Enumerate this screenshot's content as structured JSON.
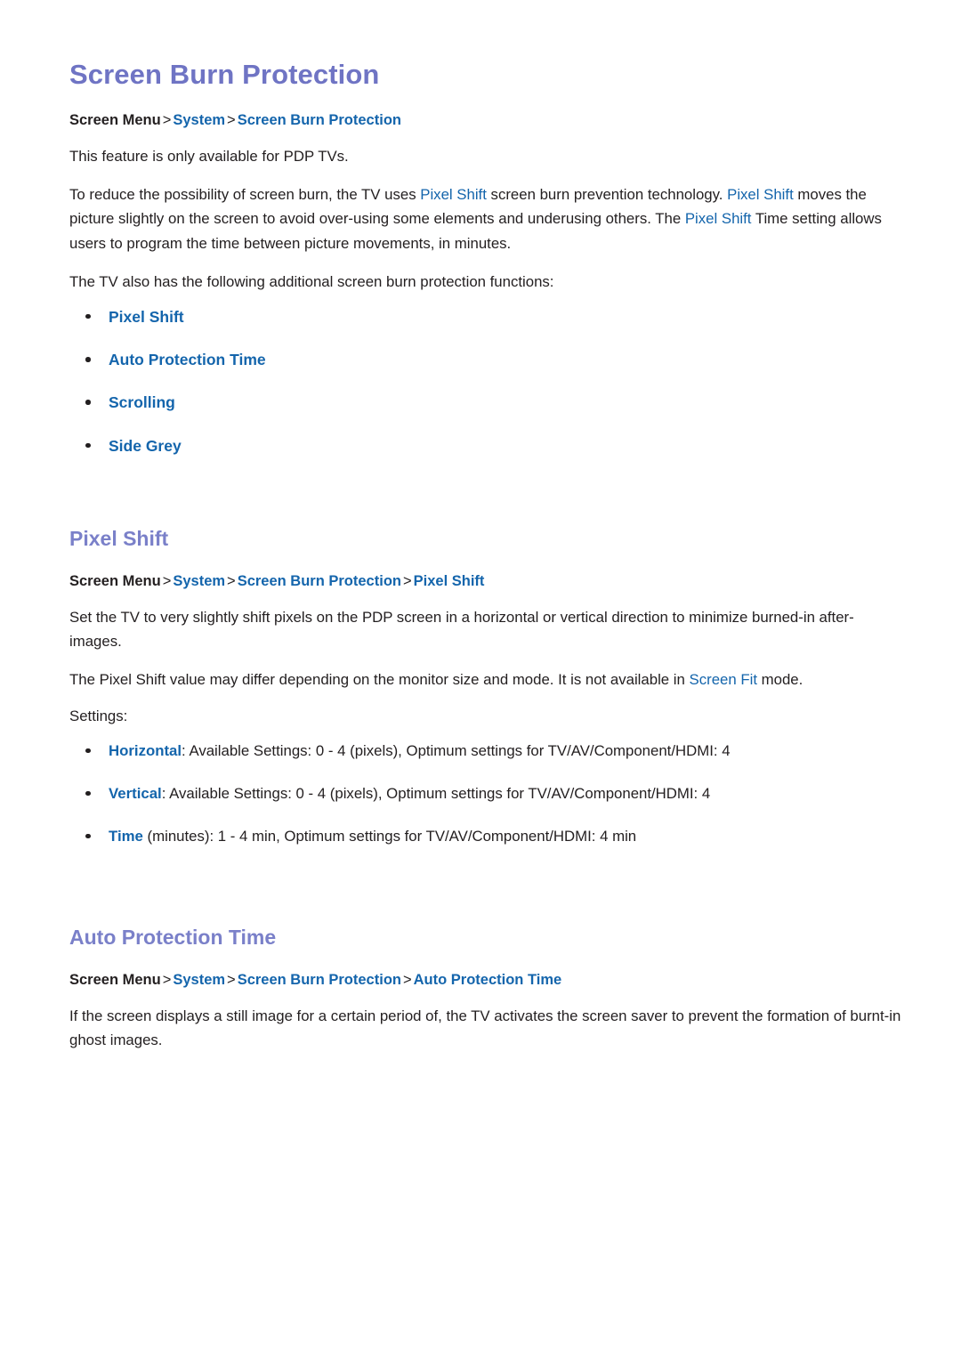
{
  "document": {
    "title": "Screen Burn Protection",
    "breadcrumb_root": "Screen Menu",
    "separator": ">"
  },
  "colors": {
    "heading_purple": "#6f74c4",
    "link_blue": "#1465ac",
    "body_text": "#231f20",
    "background": "#ffffff"
  },
  "intro": {
    "breadcrumb": {
      "root": "Screen Menu",
      "links": [
        "System",
        "Screen Burn Protection"
      ]
    },
    "paragraph_1": "This feature is only available for PDP TVs.",
    "paragraph_2": {
      "seg_1": "To reduce the possibility of screen burn, the TV uses ",
      "link_1": "Pixel Shift",
      "seg_2": " screen burn prevention technology. ",
      "link_2": "Pixel Shift",
      "seg_3": " moves the picture slightly on the screen to avoid over-using some elements and underusing others. The ",
      "link_3": "Pixel Shift",
      "seg_4": " Time setting allows users to program the time between picture movements, in minutes."
    },
    "paragraph_3": "The TV also has the following additional screen burn protection functions:",
    "function_links": [
      "Pixel Shift",
      "Auto Protection Time",
      "Scrolling",
      "Side Grey"
    ]
  },
  "pixel_shift": {
    "heading": "Pixel Shift",
    "breadcrumb": {
      "root": "Screen Menu",
      "links": [
        "System",
        "Screen Burn Protection",
        "Pixel Shift"
      ]
    },
    "paragraph_1": "Set the TV to very slightly shift pixels on the PDP screen in a horizontal or vertical direction to minimize burned-in after-images.",
    "paragraph_2": {
      "seg_1": "The Pixel Shift value may differ depending on the monitor size and mode. It is not available in ",
      "link_1": "Screen Fit",
      "seg_2": " mode."
    },
    "settings_label": "Settings:",
    "settings": [
      {
        "name": "Horizontal",
        "detail": ": Available Settings: 0 - 4 (pixels), Optimum settings for TV/AV/Component/HDMI: 4"
      },
      {
        "name": "Vertical",
        "detail": ": Available Settings: 0 - 4 (pixels), Optimum settings for TV/AV/Component/HDMI: 4"
      },
      {
        "name": "Time",
        "detail": " (minutes): 1 - 4 min, Optimum settings for TV/AV/Component/HDMI: 4 min"
      }
    ]
  },
  "auto_protection_time": {
    "heading": "Auto Protection Time",
    "breadcrumb": {
      "root": "Screen Menu",
      "links": [
        "System",
        "Screen Burn Protection",
        "Auto Protection Time"
      ]
    },
    "paragraph_1": "If the screen displays a still image for a certain period of, the TV activates the screen saver to prevent the formation of burnt-in ghost images."
  }
}
